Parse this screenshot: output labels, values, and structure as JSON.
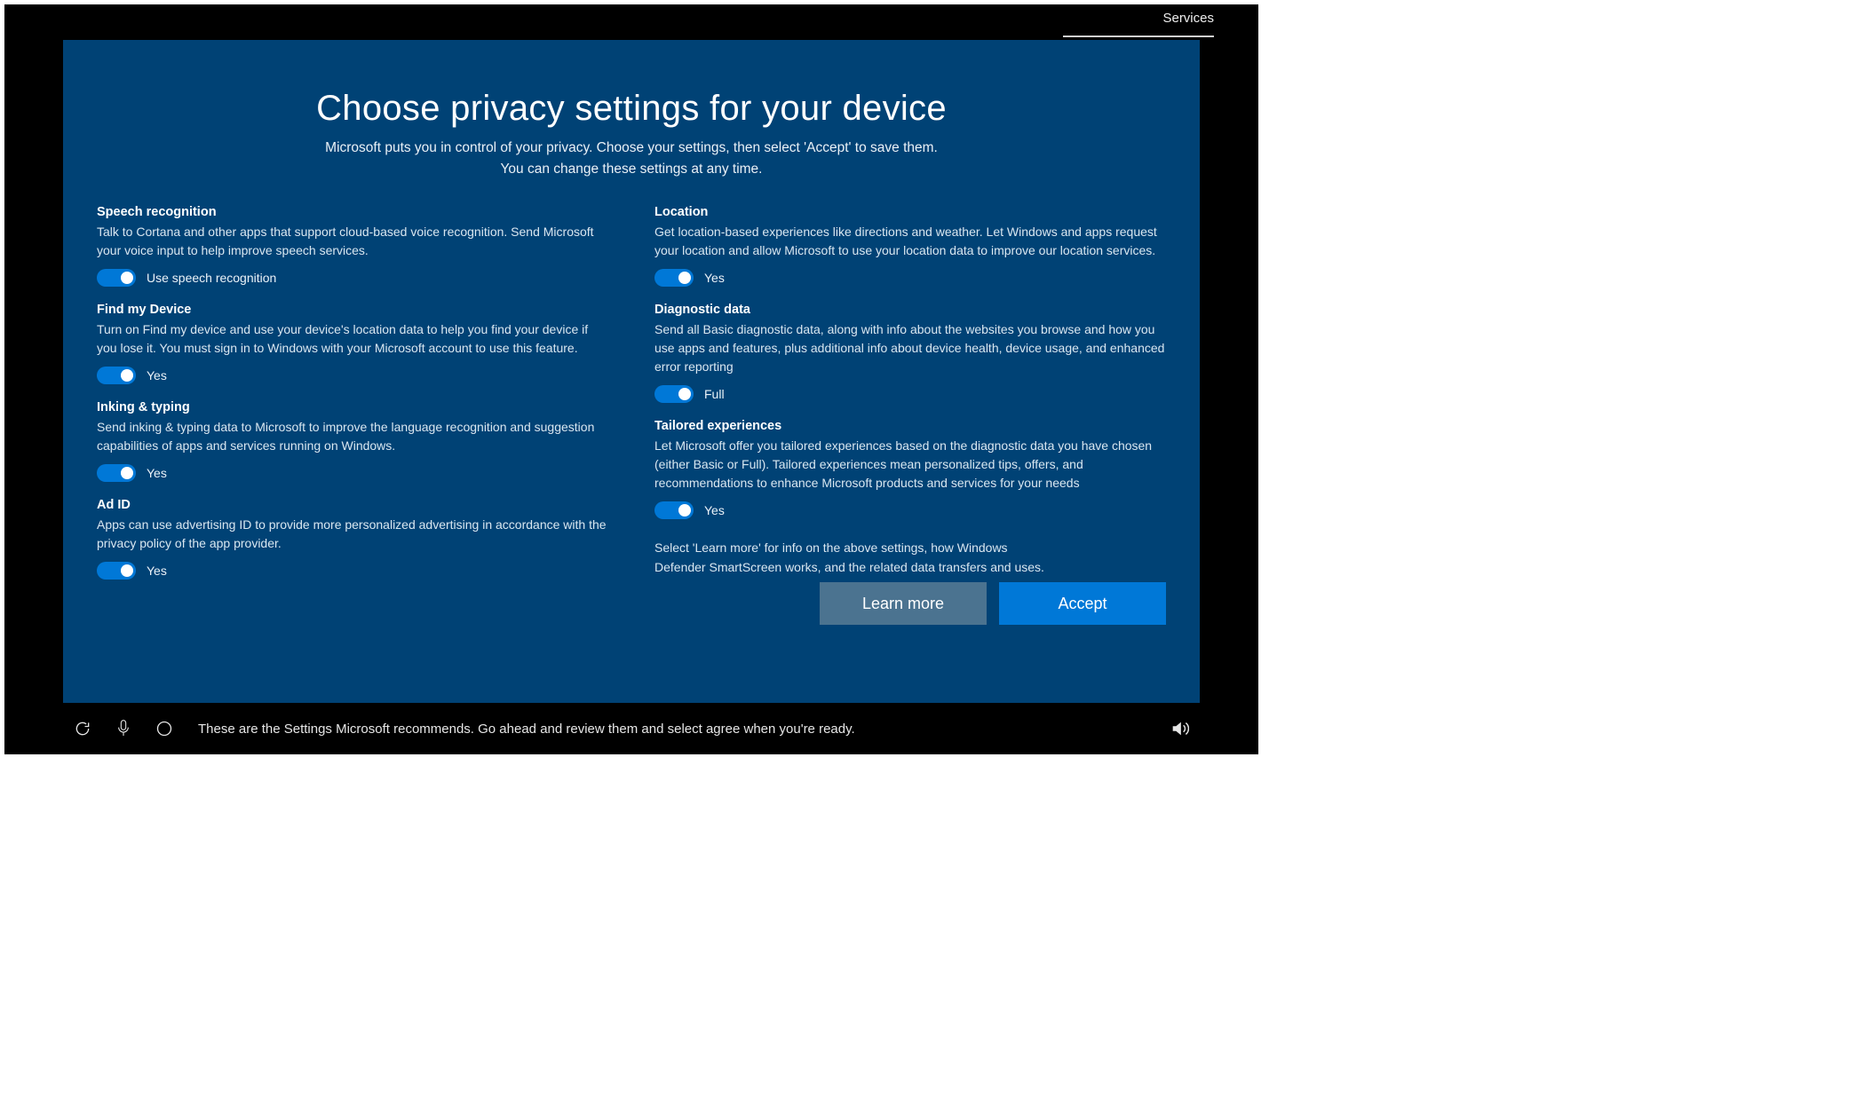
{
  "tab": {
    "label": "Services"
  },
  "header": {
    "title": "Choose privacy settings for your device",
    "subtitle_line1": "Microsoft puts you in control of your privacy. Choose your settings, then select 'Accept' to save them.",
    "subtitle_line2": "You can change these settings at any time."
  },
  "left": [
    {
      "title": "Speech recognition",
      "desc": "Talk to Cortana and other apps that support cloud-based voice recognition.  Send Microsoft your voice input to help improve speech services.",
      "toggle_label": "Use speech recognition"
    },
    {
      "title": "Find my Device",
      "desc": "Turn on Find my device and use your device's location data to help you find your device if you lose it. You must sign in to Windows with your Microsoft account to use this feature.",
      "toggle_label": "Yes"
    },
    {
      "title": "Inking & typing",
      "desc": "Send inking & typing data to Microsoft to improve the language recognition and suggestion capabilities of apps and services running on Windows.",
      "toggle_label": "Yes"
    },
    {
      "title": "Ad ID",
      "desc": "Apps can use advertising ID to provide more personalized advertising in accordance with the privacy policy of the app provider.",
      "toggle_label": "Yes"
    }
  ],
  "right": [
    {
      "title": "Location",
      "desc": "Get location-based experiences like directions and weather.  Let Windows and apps request your location and allow Microsoft to use your location data to improve our location services.",
      "toggle_label": "Yes"
    },
    {
      "title": "Diagnostic data",
      "desc": "Send all Basic diagnostic data, along with info about the websites you browse and how you use apps and features, plus additional info about device health, device usage, and enhanced error reporting",
      "toggle_label": "Full"
    },
    {
      "title": "Tailored experiences",
      "desc": "Let Microsoft offer you tailored experiences based on the diagnostic data you have chosen (either Basic or Full). Tailored experiences mean personalized tips, offers, and recommendations to enhance Microsoft products and services for your needs",
      "toggle_label": "Yes"
    }
  ],
  "hint_line1": "Select 'Learn more' for info on the above settings, how Windows",
  "hint_line2": "Defender SmartScreen works, and the related data transfers and uses.",
  "buttons": {
    "learn_more": "Learn more",
    "accept": "Accept"
  },
  "bottom": {
    "text": "These are the Settings Microsoft recommends. Go ahead and review them and select agree when you're ready."
  }
}
